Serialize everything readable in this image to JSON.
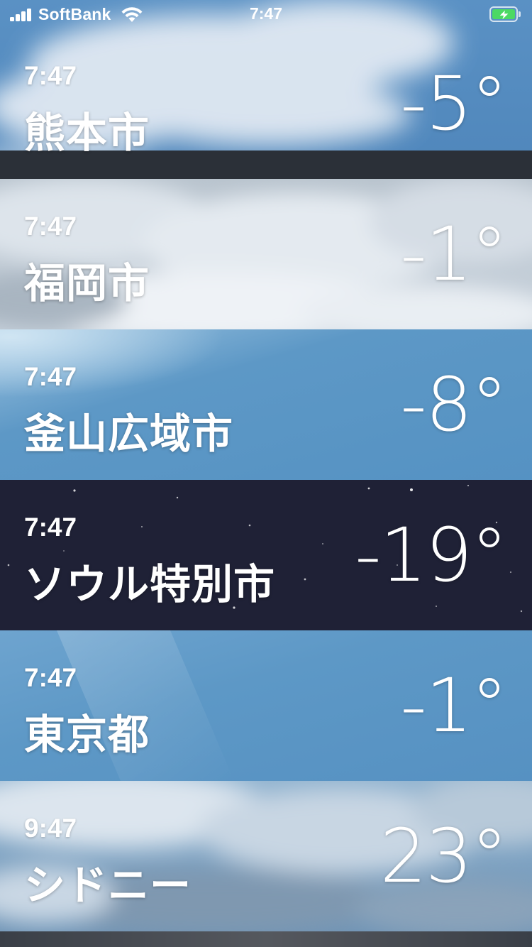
{
  "status_bar": {
    "carrier": "SoftBank",
    "time": "7:47",
    "battery_state": "charging",
    "colors": {
      "battery_fill": "#4cd964"
    }
  },
  "cities": [
    {
      "time": "7:47",
      "name": "熊本市",
      "temp": "-5°",
      "theme": "cloudy-day",
      "color": "#5b93c2"
    },
    {
      "time": "7:47",
      "name": "福岡市",
      "temp": "-1°",
      "theme": "overcast",
      "color": "#c9d3dc"
    },
    {
      "time": "7:47",
      "name": "釜山広域市",
      "temp": "-8°",
      "theme": "clear-day",
      "color": "#5a95c3"
    },
    {
      "time": "7:47",
      "name": "ソウル特別市",
      "temp": "-19°",
      "theme": "clear-night",
      "color": "#1f2136"
    },
    {
      "time": "7:47",
      "name": "東京都",
      "temp": "-1°",
      "theme": "clear-day",
      "color": "#5c97c5"
    },
    {
      "time": "9:47",
      "name": "シドニー",
      "temp": "23°",
      "theme": "cloudy-day",
      "color": "#8fb2cf"
    }
  ]
}
